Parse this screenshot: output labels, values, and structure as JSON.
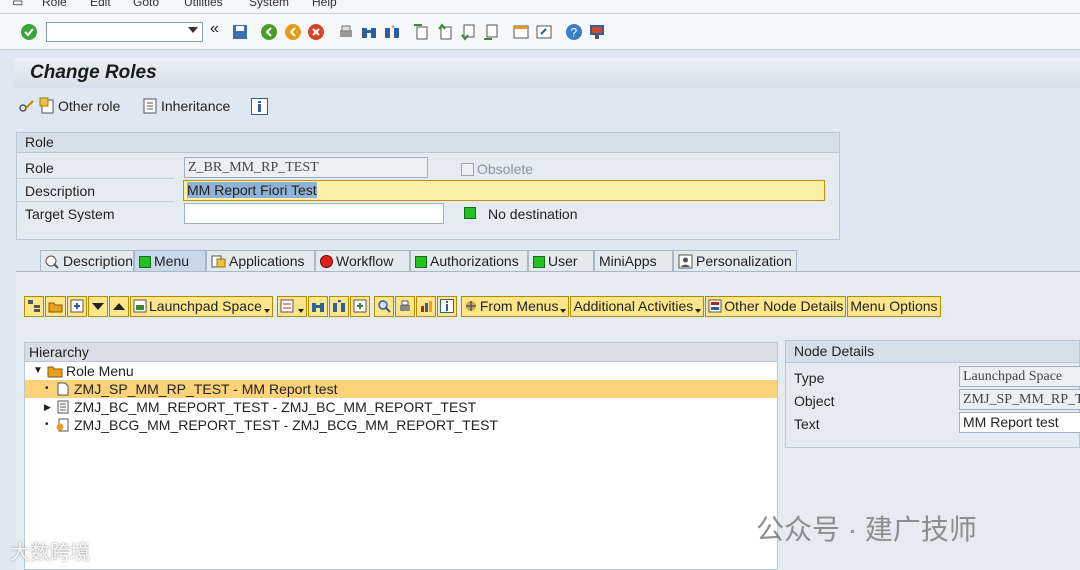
{
  "menu": [
    "Role",
    "Edit",
    "Goto",
    "Utilities",
    "System",
    "Help"
  ],
  "title": "Change Roles",
  "app_toolbar": {
    "other_role": "Other role",
    "inheritance": "Inheritance"
  },
  "role_group": {
    "header": "Role",
    "role_label": "Role",
    "role_value": "Z_BR_MM_RP_TEST",
    "obsolete_label": "Obsolete",
    "description_label": "Description",
    "description_value": "MM Report Fiori Test",
    "target_system_label": "Target System",
    "target_system_value": "",
    "destination_status": "No destination",
    "status_color": "#22c022"
  },
  "tabs": [
    "Description",
    "Menu",
    "Applications",
    "Workflow",
    "Authorizations",
    "User",
    "MiniApps",
    "Personalization"
  ],
  "menu_toolbar": {
    "launchpad_space": "Launchpad Space",
    "from_menus": "From Menus",
    "additional_activities": "Additional Activities",
    "other_node_details": "Other Node Details",
    "menu_options": "Menu Options"
  },
  "hierarchy": {
    "header": "Hierarchy",
    "root": "Role Menu",
    "nodes": [
      "ZMJ_SP_MM_RP_TEST - MM Report test",
      "ZMJ_BC_MM_REPORT_TEST - ZMJ_BC_MM_REPORT_TEST",
      "ZMJ_BCG_MM_REPORT_TEST - ZMJ_BCG_MM_REPORT_TEST"
    ]
  },
  "node_details": {
    "header": "Node Details",
    "type_label": "Type",
    "type_value": "Launchpad Space",
    "object_label": "Object",
    "object_value": "ZMJ_SP_MM_RP_TEST",
    "text_label": "Text",
    "text_value": "MM Report test"
  },
  "watermarks": {
    "left": "大数跨境",
    "right": "公众号 · 建广技师"
  }
}
